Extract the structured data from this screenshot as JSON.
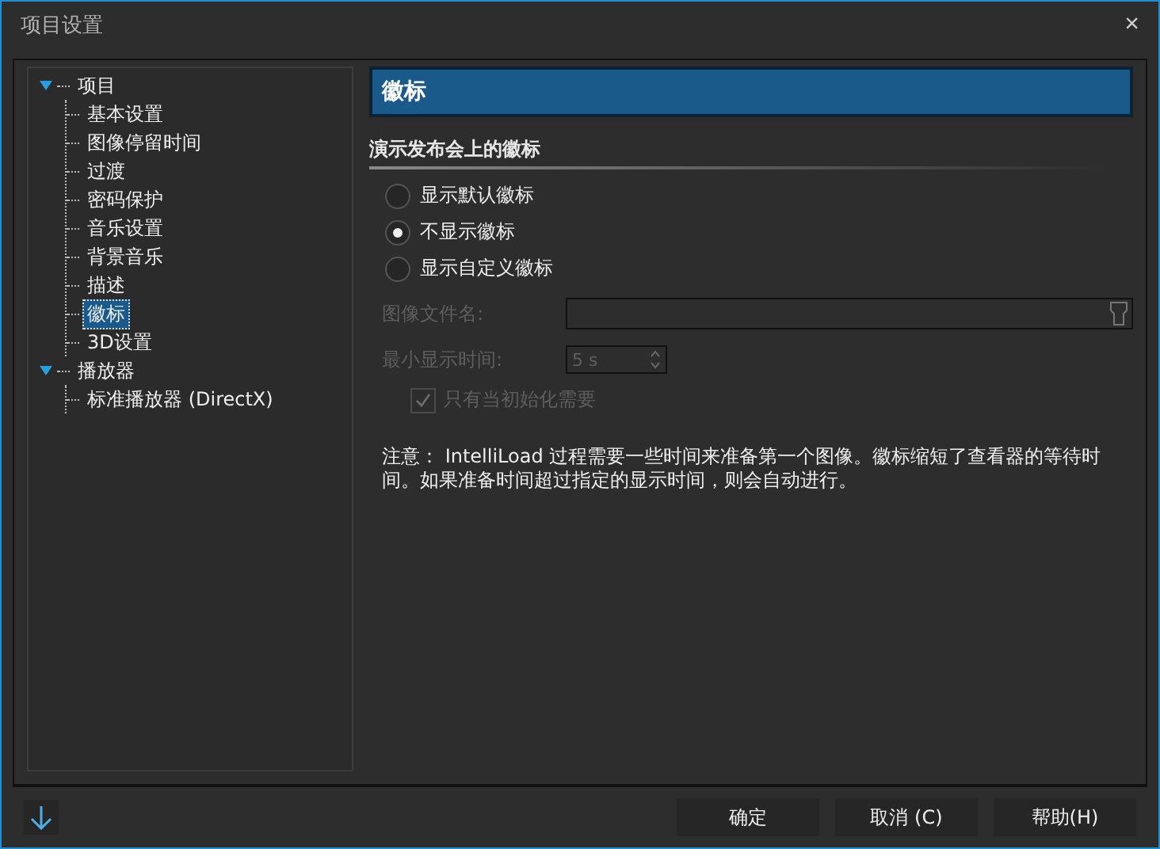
{
  "window": {
    "title": "项目设置",
    "close": "×"
  },
  "tree": [
    {
      "label": "项目",
      "expanded": true,
      "selected": false,
      "children": [
        {
          "label": "基本设置",
          "selected": false
        },
        {
          "label": "图像停留时间",
          "selected": false
        },
        {
          "label": "过渡",
          "selected": false
        },
        {
          "label": "密码保护",
          "selected": false
        },
        {
          "label": "音乐设置",
          "selected": false
        },
        {
          "label": "背景音乐",
          "selected": false
        },
        {
          "label": "描述",
          "selected": false
        },
        {
          "label": "徽标",
          "selected": true
        },
        {
          "label": "3D设置",
          "selected": false
        }
      ]
    },
    {
      "label": "播放器",
      "expanded": true,
      "selected": false,
      "children": [
        {
          "label": "标准播放器 (DirectX)",
          "selected": false
        }
      ]
    }
  ],
  "panel": {
    "title": "徽标",
    "section": "演示发布会上的徽标",
    "radios": [
      {
        "label": "显示默认徽标",
        "selected": false
      },
      {
        "label": "不显示徽标",
        "selected": true
      },
      {
        "label": "显示自定义徽标",
        "selected": false
      }
    ],
    "file_label": "图像文件名:",
    "time_label": "最小显示时间:",
    "time_value": "5 s",
    "disabled": true,
    "checkbox": {
      "label": "只有当初始化需要",
      "checked": true
    },
    "note": "注意： IntelliLoad 过程需要一些时间来准备第一个图像。徽标缩短了查看器的等待时间。如果准备时间超过指定的显示时间，则会自动进行。"
  },
  "buttons": [
    "确定",
    "取消 (C)",
    "帮助(H)"
  ]
}
